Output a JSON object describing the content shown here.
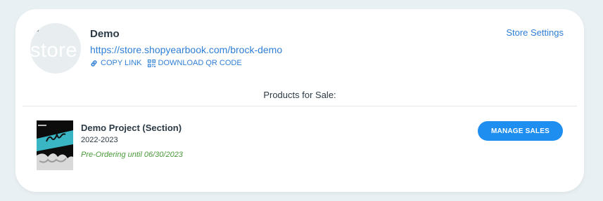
{
  "store": {
    "avatar_alt": "store",
    "name": "Demo",
    "url": "https://store.shopyearbook.com/brock-demo",
    "copy_link_label": "COPY LINK",
    "download_qr_label": "DOWNLOAD QR CODE",
    "settings_label": "Store Settings"
  },
  "products_section": {
    "title": "Products for Sale:"
  },
  "products": [
    {
      "name": "Demo Project (Section)",
      "year": "2022-2023",
      "status": "Pre-Ordering until 06/30/2023",
      "manage_label": "MANAGE SALES"
    }
  ],
  "colors": {
    "background": "#e9f0f3",
    "card": "#ffffff",
    "link": "#2f7fd6",
    "button": "#1e8ef0",
    "status_green": "#4a9a3a",
    "text": "#2c3a45"
  },
  "icons": {
    "copy_link": "link-icon",
    "download_qr": "qr-code-icon",
    "avatar": "broken-image-icon"
  }
}
